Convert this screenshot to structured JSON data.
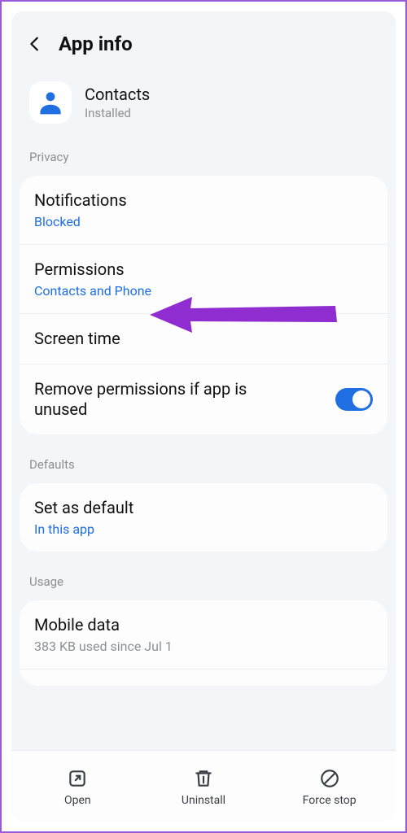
{
  "header": {
    "title": "App info"
  },
  "app": {
    "name": "Contacts",
    "status": "Installed"
  },
  "sections": {
    "privacy_label": "Privacy",
    "defaults_label": "Defaults",
    "usage_label": "Usage"
  },
  "privacy": {
    "notifications": {
      "title": "Notifications",
      "value": "Blocked"
    },
    "permissions": {
      "title": "Permissions",
      "value": "Contacts and Phone"
    },
    "screen_time": {
      "title": "Screen time"
    },
    "remove_perms": {
      "title": "Remove permissions if app is unused",
      "toggle": true
    }
  },
  "defaults": {
    "set_default": {
      "title": "Set as default",
      "value": "In this app"
    }
  },
  "usage": {
    "mobile_data": {
      "title": "Mobile data",
      "value": "383 KB used since Jul 1"
    }
  },
  "bottom_bar": {
    "open": "Open",
    "uninstall": "Uninstall",
    "force_stop": "Force stop"
  },
  "colors": {
    "accent": "#1f6fe2",
    "border": "#985bd9",
    "arrow": "#8f2dd1"
  }
}
